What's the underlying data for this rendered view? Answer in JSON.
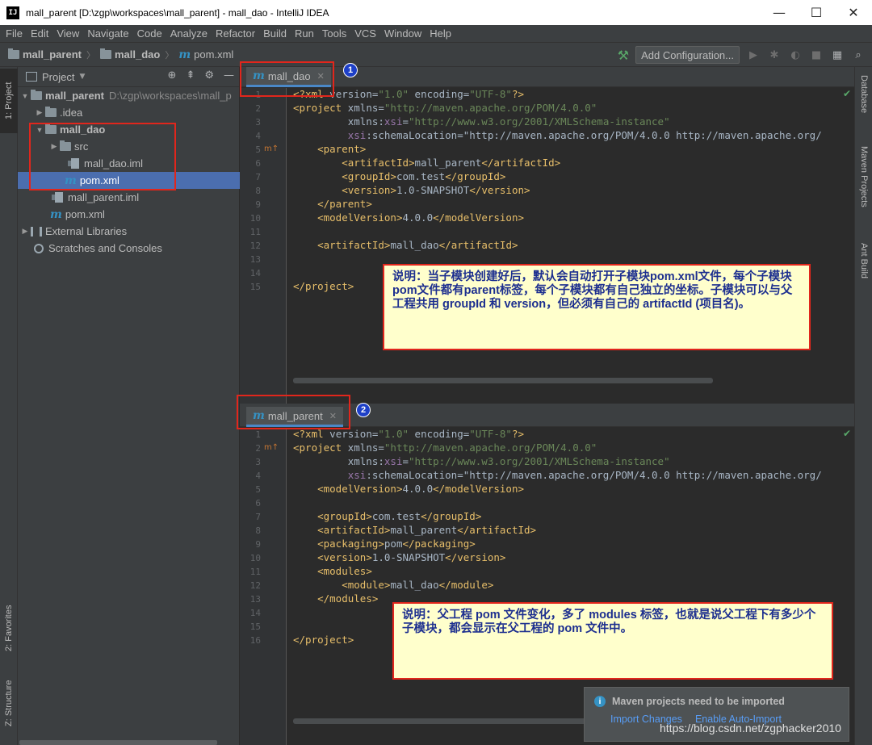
{
  "window": {
    "title": "mall_parent [D:\\zgp\\workspaces\\mall_parent] - mall_dao - IntelliJ IDEA",
    "app_icon_text": "IJ",
    "minimize": "—",
    "maximize": "☐",
    "close": "✕"
  },
  "menu": [
    "File",
    "Edit",
    "View",
    "Navigate",
    "Code",
    "Analyze",
    "Refactor",
    "Build",
    "Run",
    "Tools",
    "VCS",
    "Window",
    "Help"
  ],
  "breadcrumb": [
    "mall_parent",
    "mall_dao",
    "pom.xml"
  ],
  "toolbar": {
    "add_configuration": "Add Configuration..."
  },
  "left_strip": {
    "project_tab": "1: Project",
    "favorites_tab": "2: Favorites",
    "structure_tab": "Z: Structure"
  },
  "right_strip": {
    "database_tab": "Database",
    "maven_tab": "Maven Projects",
    "ant_tab": "Ant Build"
  },
  "project_panel": {
    "title": "Project",
    "tree": [
      {
        "label": "mall_parent",
        "path": "D:\\zgp\\workspaces\\mall_p"
      },
      {
        "label": ".idea"
      },
      {
        "label": "mall_dao"
      },
      {
        "label": "src"
      },
      {
        "label": "mall_dao.iml"
      },
      {
        "label": "pom.xml"
      },
      {
        "label": "mall_parent.iml"
      },
      {
        "label": "pom.xml"
      },
      {
        "label": "External Libraries"
      },
      {
        "label": "Scratches and Consoles"
      }
    ]
  },
  "editor_top": {
    "tab_label": "mall_dao",
    "badge": "1",
    "line_numbers": [
      "1",
      "2",
      "3",
      "4",
      "5",
      "6",
      "7",
      "8",
      "9",
      "10",
      "11",
      "12",
      "13",
      "14",
      "15"
    ],
    "lines": [
      "<?xml version=\"1.0\" encoding=\"UTF-8\"?>",
      "<project xmlns=\"http://maven.apache.org/POM/4.0.0\"",
      "         xmlns:xsi=\"http://www.w3.org/2001/XMLSchema-instance\"",
      "         xsi:schemaLocation=\"http://maven.apache.org/POM/4.0.0 http://maven.apache.org/",
      "    <parent>",
      "        <artifactId>mall_parent</artifactId>",
      "        <groupId>com.test</groupId>",
      "        <version>1.0-SNAPSHOT</version>",
      "    </parent>",
      "    <modelVersion>4.0.0</modelVersion>",
      "",
      "    <artifactId>mall_dao</artifactId>",
      "",
      "",
      "</project>"
    ],
    "note": "说明：当子模块创建好后，默认会自动打开子模块pom.xml文件，每个子模块pom文件都有parent标签，每个子模块都有自己独立的坐标。子模块可以与父工程共用 groupId 和 version，但必须有自己的 artifactId (项目名)。"
  },
  "editor_bottom": {
    "tab_label": "mall_parent",
    "badge": "2",
    "line_numbers": [
      "1",
      "2",
      "3",
      "4",
      "5",
      "6",
      "7",
      "8",
      "9",
      "10",
      "11",
      "12",
      "13",
      "14",
      "15",
      "16"
    ],
    "lines": [
      "<?xml version=\"1.0\" encoding=\"UTF-8\"?>",
      "<project xmlns=\"http://maven.apache.org/POM/4.0.0\"",
      "         xmlns:xsi=\"http://www.w3.org/2001/XMLSchema-instance\"",
      "         xsi:schemaLocation=\"http://maven.apache.org/POM/4.0.0 http://maven.apache.org/",
      "    <modelVersion>4.0.0</modelVersion>",
      "",
      "    <groupId>com.test</groupId>",
      "    <artifactId>mall_parent</artifactId>",
      "    <packaging>pom</packaging>",
      "    <version>1.0-SNAPSHOT</version>",
      "    <modules>",
      "        <module>mall_dao</module>",
      "    </modules>",
      "",
      "",
      "</project>"
    ],
    "note": "说明：父工程 pom 文件变化，多了 modules 标签，也就是说父工程下有多少个子模块，都会显示在父工程的 pom 文件中。"
  },
  "notification": {
    "message": "Maven projects need to be imported",
    "import_changes": "Import Changes",
    "enable_auto_import": "Enable Auto-Import"
  },
  "watermark": "https://blog.csdn.net/zgphacker2010"
}
